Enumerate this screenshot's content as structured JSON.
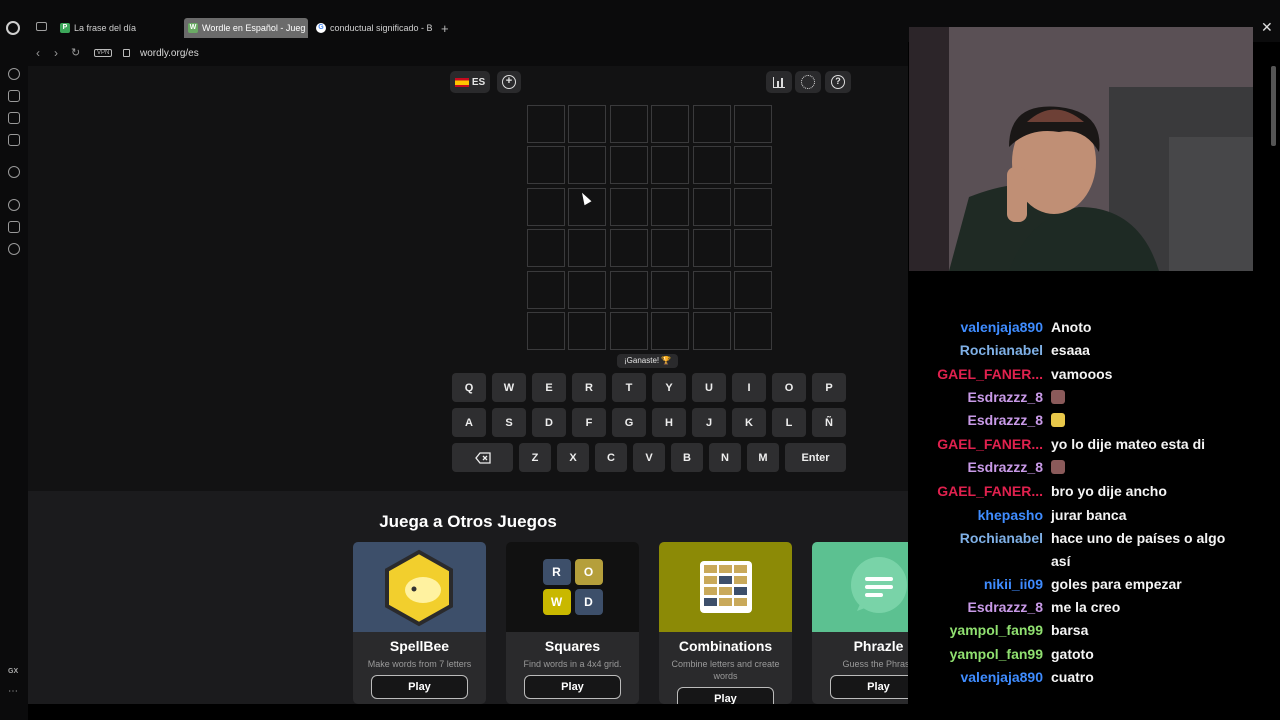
{
  "browser": {
    "tabs": [
      {
        "label": "La frase del día",
        "favicon": "P",
        "color": "#3ca75a"
      },
      {
        "label": "Wordle en Español - Jueg",
        "favicon": "W",
        "color": "#6aaa64"
      },
      {
        "label": "conductual significado - B",
        "favicon": "G",
        "color": "#4285f4"
      }
    ],
    "vpn_label": "VPN",
    "url": "wordly.org/es",
    "sidebar_bottom": "GX"
  },
  "game": {
    "language_label": "ES",
    "win_message": "¡Ganaste! 🏆",
    "board_rows": 6,
    "board_cols": 6,
    "keyboard": {
      "row1": [
        "Q",
        "W",
        "E",
        "R",
        "T",
        "Y",
        "U",
        "I",
        "O",
        "P"
      ],
      "row2": [
        "A",
        "S",
        "D",
        "F",
        "G",
        "H",
        "J",
        "K",
        "L",
        "Ñ"
      ],
      "row3": [
        "Z",
        "X",
        "C",
        "V",
        "B",
        "N",
        "M"
      ],
      "enter": "Enter",
      "backspace_icon": "backspace-icon"
    }
  },
  "other_games": {
    "title": "Juega a Otros Juegos",
    "play_label": "Play",
    "cards": [
      {
        "name": "SpellBee",
        "desc": "Make words from 7 letters",
        "bg": "#3d4f6a"
      },
      {
        "name": "Squares",
        "desc": "Find words in a 4x4 grid.",
        "bg": "#111"
      },
      {
        "name": "Combinations",
        "desc": "Combine letters and create words",
        "bg": "#8c8a06"
      },
      {
        "name": "Phrazle",
        "desc": "Guess the Phrase",
        "bg": "#5cc191"
      }
    ],
    "squares_letters": [
      "R",
      "O",
      "W",
      "D"
    ]
  },
  "chat": [
    {
      "user": "valenjaja890",
      "color": "#3f8cff",
      "text": "Anoto"
    },
    {
      "user": "Rochianabel",
      "color": "#7fb0e6",
      "text": "esaaa"
    },
    {
      "user": "GAEL_FANER...",
      "color": "#e0214e",
      "text": "vamooos"
    },
    {
      "user": "Esdrazzz_8",
      "color": "#c99ae8",
      "text": "",
      "emote": "emote-face"
    },
    {
      "user": "Esdrazzz_8",
      "color": "#c99ae8",
      "text": "",
      "emote": "emote-yellow"
    },
    {
      "user": "GAEL_FANER...",
      "color": "#e0214e",
      "text": "yo lo dije mateo esta di"
    },
    {
      "user": "Esdrazzz_8",
      "color": "#c99ae8",
      "text": "",
      "emote": "emote-face"
    },
    {
      "user": "GAEL_FANER...",
      "color": "#e0214e",
      "text": "bro yo dije ancho"
    },
    {
      "user": "khepasho",
      "color": "#3f8cff",
      "text": "jurar banca"
    },
    {
      "user": "Rochianabel",
      "color": "#7fb0e6",
      "text": "hace uno de países o algo así"
    },
    {
      "user": "nikii_ii09",
      "color": "#3f8cff",
      "text": "goles para empezar"
    },
    {
      "user": "Esdrazzz_8",
      "color": "#c99ae8",
      "text": "me la creo"
    },
    {
      "user": "yampol_fan99",
      "color": "#90e070",
      "text": "barsa"
    },
    {
      "user": "yampol_fan99",
      "color": "#90e070",
      "text": "gatoto"
    },
    {
      "user": "valenjaja890",
      "color": "#3f8cff",
      "text": "cuatro"
    }
  ]
}
